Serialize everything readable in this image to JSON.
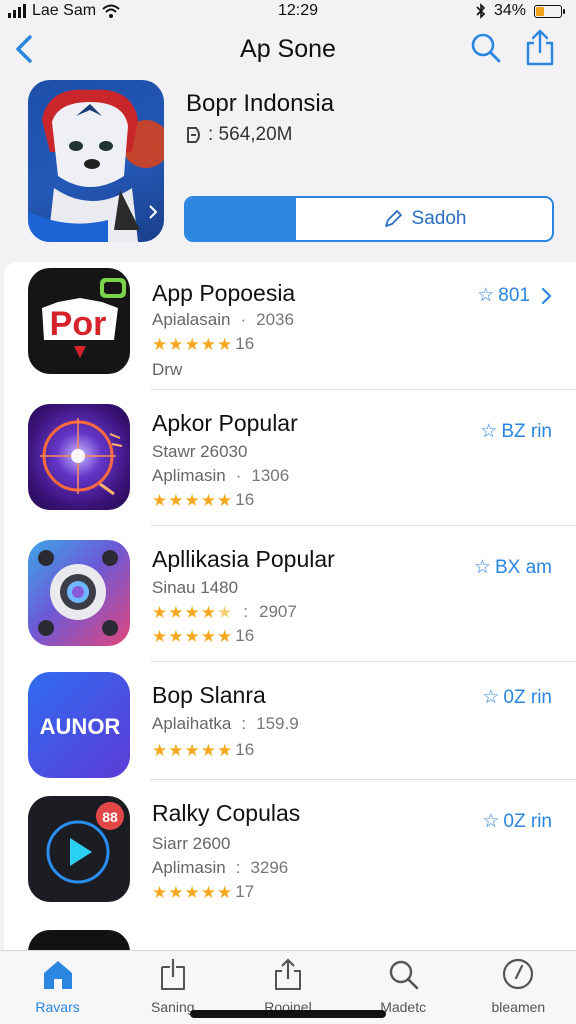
{
  "status_bar": {
    "carrier": "Lae Sam",
    "time": "12:29",
    "battery": "34%",
    "battery_level": 0.34
  },
  "nav": {
    "title": "Ap Sone",
    "back_icon": "chevron-left-icon",
    "search_icon": "search-icon",
    "share_icon": "share-icon"
  },
  "featured": {
    "title": "Bopr Indonsia",
    "meta_icon": "arrow-right-icon",
    "meta": ": 564,20M",
    "progress_label": "Sadoh",
    "progress_fraction": 0.3
  },
  "apps": [
    {
      "name": "App Popoesia",
      "line1": "Apialasain",
      "line1_value": "2036",
      "rating_count": "16",
      "rating": 5,
      "line3": "Drw",
      "action": "801",
      "action_chevron": true
    },
    {
      "name": "Apkor Popular",
      "line1": "Stawr 26030",
      "line2": "Aplimasin",
      "line2_value": "1306",
      "rating_count": "16",
      "rating": 5,
      "action": "BZ rin"
    },
    {
      "name": "Apllikasia Popular",
      "line1": "Sinau 1480",
      "rating_mid": 4.5,
      "rating_mid_value": "2907",
      "rating_count": "16",
      "rating": 5,
      "action": "BX am"
    },
    {
      "name": "Bop Slanra",
      "line1": "Aplaihatka",
      "line1_value": "159.9",
      "rating_count": "16",
      "rating": 5,
      "action": "0Z rin"
    },
    {
      "name": "Ralky Copulas",
      "line1": "Siarr 2600",
      "line2": "Aplimasin",
      "line2_value": "3296",
      "rating_count": "17",
      "rating": 5,
      "action": "0Z rin"
    }
  ],
  "tabs": [
    {
      "label": "Ravars",
      "icon": "home-icon",
      "active": true
    },
    {
      "label": "Saning",
      "icon": "bookmark-icon",
      "active": false
    },
    {
      "label": "Rooinel",
      "icon": "share-icon",
      "active": false
    },
    {
      "label": "Madetc",
      "icon": "search-icon",
      "active": false
    },
    {
      "label": "bleamen",
      "icon": "clock-icon",
      "active": false
    }
  ]
}
